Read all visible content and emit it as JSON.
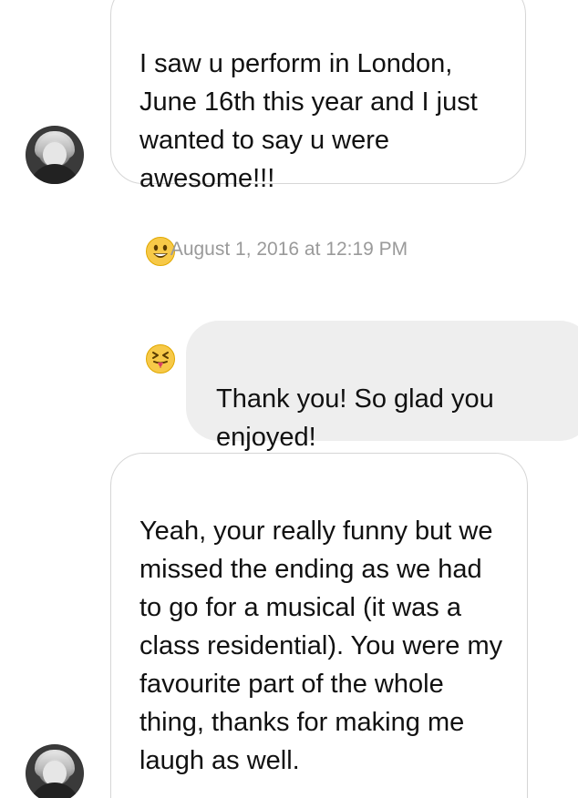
{
  "conversation": {
    "messages": [
      {
        "from": "them",
        "text": "I saw u perform in London, June 16th this year and I just wanted to say u were awesome!!!",
        "emojis": [
          "grinning-face-emoji",
          "tongue-out-face-emoji"
        ]
      },
      {
        "from": "me",
        "text": "Thank you!  So glad you enjoyed!"
      },
      {
        "from": "them",
        "text": "Yeah, your really funny but we missed the ending as we had to go for a musical (it was a class residential). You were my favourite part of the whole thing, thanks for making me laugh as well."
      }
    ],
    "timestamp": "August 1, 2016 at 12:19 PM"
  },
  "colors": {
    "incoming_bg": "#ffffff",
    "incoming_border": "#d6d6d6",
    "outgoing_bg": "#eeeeee",
    "text": "#111111",
    "timestamp": "#9a9a9a"
  }
}
